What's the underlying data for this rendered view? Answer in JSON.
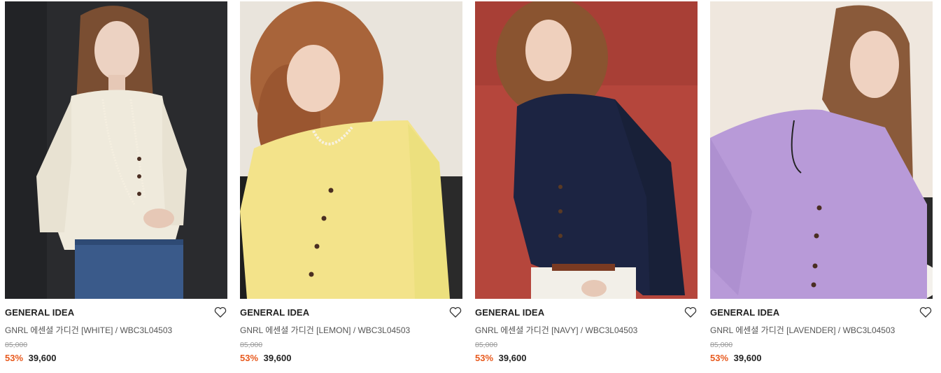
{
  "products": [
    {
      "brand": "GENERAL IDEA",
      "name": "GNRL 에센셜 가디건 [WHITE] / WBC3L04503",
      "original_price": "85,000",
      "discount": "53%",
      "price": "39,600",
      "photo": {
        "background": "#2a2b2e",
        "garment": "#efeadc",
        "hair": "#7a4e32",
        "bottom": "#3a5a8a"
      }
    },
    {
      "brand": "GENERAL IDEA",
      "name": "GNRL 에센셜 가디건 [LEMON] / WBC3L04503",
      "original_price": "85,000",
      "discount": "53%",
      "price": "39,600",
      "photo": {
        "background": "#e9e4dc",
        "garment": "#f3e38a",
        "hair": "#a8643a",
        "bottom": "#1e1e1e"
      }
    },
    {
      "brand": "GENERAL IDEA",
      "name": "GNRL 에센셜 가디건 [NAVY] / WBC3L04503",
      "original_price": "85,000",
      "discount": "53%",
      "price": "39,600",
      "photo": {
        "background": "#b5463c",
        "garment": "#1c2442",
        "hair": "#8a5430",
        "bottom": "#f2efe8"
      }
    },
    {
      "brand": "GENERAL IDEA",
      "name": "GNRL 에센셜 가디건 [LAVENDER] / WBC3L04503",
      "original_price": "85,000",
      "discount": "53%",
      "price": "39,600",
      "photo": {
        "background": "#efe7de",
        "garment": "#b89ad8",
        "hair": "#8a5a3a",
        "bottom": "#2a2a2a"
      }
    }
  ],
  "icons": {
    "wishlist": "heart-outline-icon"
  },
  "colors": {
    "discount": "#e85a1e",
    "text": "#222222",
    "muted": "#9a9a9a"
  }
}
